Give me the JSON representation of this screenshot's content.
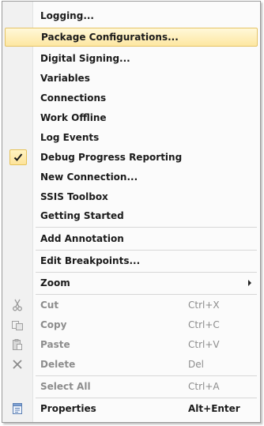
{
  "menu": {
    "logging": "Logging...",
    "package_configurations": "Package Configurations...",
    "digital_signing": "Digital Signing...",
    "variables": "Variables",
    "connections": "Connections",
    "work_offline": "Work Offline",
    "log_events": "Log Events",
    "debug_progress_reporting": "Debug Progress Reporting",
    "debug_progress_reporting_checked": true,
    "new_connection": "New Connection...",
    "ssis_toolbox": "SSIS Toolbox",
    "getting_started": "Getting Started",
    "add_annotation": "Add Annotation",
    "edit_breakpoints": "Edit Breakpoints...",
    "zoom": "Zoom",
    "cut": "Cut",
    "cut_shortcut": "Ctrl+X",
    "copy": "Copy",
    "copy_shortcut": "Ctrl+C",
    "paste": "Paste",
    "paste_shortcut": "Ctrl+V",
    "delete": "Delete",
    "delete_shortcut": "Del",
    "select_all": "Select All",
    "select_all_shortcut": "Ctrl+A",
    "properties": "Properties",
    "properties_shortcut": "Alt+Enter"
  },
  "icons": {
    "check": "check-icon",
    "cut": "scissors-icon",
    "copy": "copy-icon",
    "paste": "paste-icon",
    "delete": "delete-x-icon",
    "properties": "properties-icon",
    "submenu": "submenu-arrow-icon"
  },
  "colors": {
    "highlight_border": "#e5c365",
    "highlight_fill": "#fde7a1",
    "disabled_text": "#8d8d8d"
  }
}
